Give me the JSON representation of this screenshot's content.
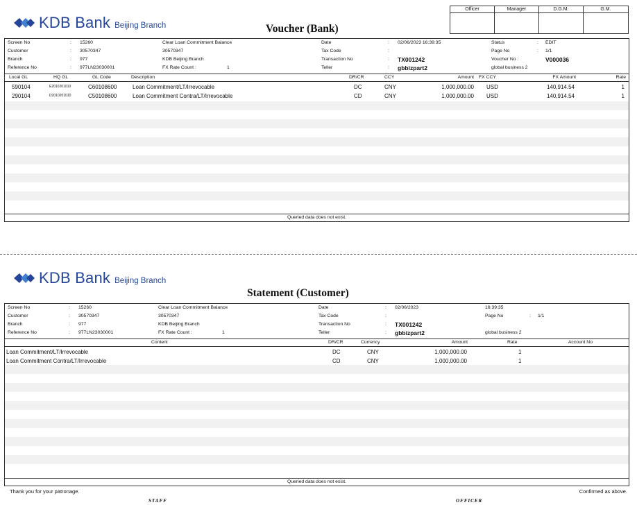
{
  "brand": {
    "name": "KDB Bank",
    "branch": "Beijing Branch",
    "accent": "#24459a"
  },
  "signoff": [
    "Officer",
    "Manager",
    "D.G.M.",
    "G.M."
  ],
  "voucher": {
    "title": "Voucher (Bank)",
    "info": {
      "screen_no_label": "Screen No",
      "screen_no": "15260",
      "customer_label": "Customer",
      "customer": "30570347",
      "branch_label": "Branch",
      "branch": "977",
      "reference_label": "Reference No",
      "reference": "977LN23030001",
      "desc1": "Clear Loan Commitment Balance",
      "desc2": "30570347",
      "desc3": "KDB Beijing Branch",
      "fx_label": "FX Rate Count :",
      "fx_count": "1",
      "date_label": "Date",
      "date": "02/06/2023   16:39:35",
      "tax_label": "Tax Code",
      "tax": "",
      "txn_label": "Transaction No",
      "txn": "TX001242",
      "teller_label": "Teller",
      "teller": "gbbizpart2",
      "status_label": "Status",
      "status": "EDIT",
      "page_label": "Page No",
      "page": "1/1",
      "voucher_no_label": "Voucher No :",
      "voucher_no": "V000036",
      "teller_group": "global business 2"
    },
    "columns": [
      "Local GL",
      "HQ GL",
      "GL Code",
      "Description",
      "DR/CR",
      "CCY",
      "Amount",
      "FX CCY",
      "FX Amount",
      "Rate"
    ],
    "rows": [
      {
        "local_gl": "590104",
        "hq_gl": "E2010201010",
        "gl_code": "C60108600",
        "desc": "Loan Commitment/LT/Irrevocable",
        "drcr": "DC",
        "ccy": "CNY",
        "amount": "1,000,000.00",
        "fx_ccy": "USD",
        "fx_amount": "140,914.54",
        "rate": "1"
      },
      {
        "local_gl": "290104",
        "hq_gl": "D2010201010",
        "gl_code": "C50108600",
        "desc": "Loan Commitment Contra/LT/Irrevocable",
        "drcr": "CD",
        "ccy": "CNY",
        "amount": "1,000,000.00",
        "fx_ccy": "USD",
        "fx_amount": "140,914.54",
        "rate": "1"
      }
    ],
    "footer": "Queried data does not exist."
  },
  "statement": {
    "title": "Statement (Customer)",
    "info": {
      "screen_no_label": "Screen No",
      "screen_no": "15260",
      "customer_label": "Customer",
      "customer": "30570347",
      "branch_label": "Branch",
      "branch": "977",
      "reference_label": "Reference No",
      "reference": "977LN23030001",
      "desc1": "Clear Loan Commitment Balance",
      "desc2": "30570347",
      "desc3": "KDB Beijing Branch",
      "fx_label": "FX Rate Count :",
      "fx_count": "1",
      "date_label": "Date",
      "date": "02/06/2023",
      "time": "16:39:35",
      "tax_label": "Tax Code",
      "tax": "",
      "txn_label": "Transaction No",
      "txn": "TX001242",
      "teller_label": "Teller",
      "teller": "gbbizpart2",
      "page_label": "Page No",
      "page": "1/1",
      "teller_group": "global business 2"
    },
    "columns": [
      "Content",
      "DR/CR",
      "Currency",
      "Amount",
      "Rate",
      "Account No"
    ],
    "rows": [
      {
        "content": "Loan Commitment/LT/Irrevocable",
        "drcr": "DC",
        "currency": "CNY",
        "amount": "1,000,000.00",
        "rate": "1",
        "account": ""
      },
      {
        "content": "Loan Commitment Contra/LT/Irrevocable",
        "drcr": "CD",
        "currency": "CNY",
        "amount": "1,000,000.00",
        "rate": "1",
        "account": ""
      }
    ],
    "footer": "Queried data does not exist.",
    "thanks": "Thank you for your patronage.",
    "confirmed": "Confirmed as above.",
    "staff": "STAFF",
    "officer": "OFFICER"
  }
}
